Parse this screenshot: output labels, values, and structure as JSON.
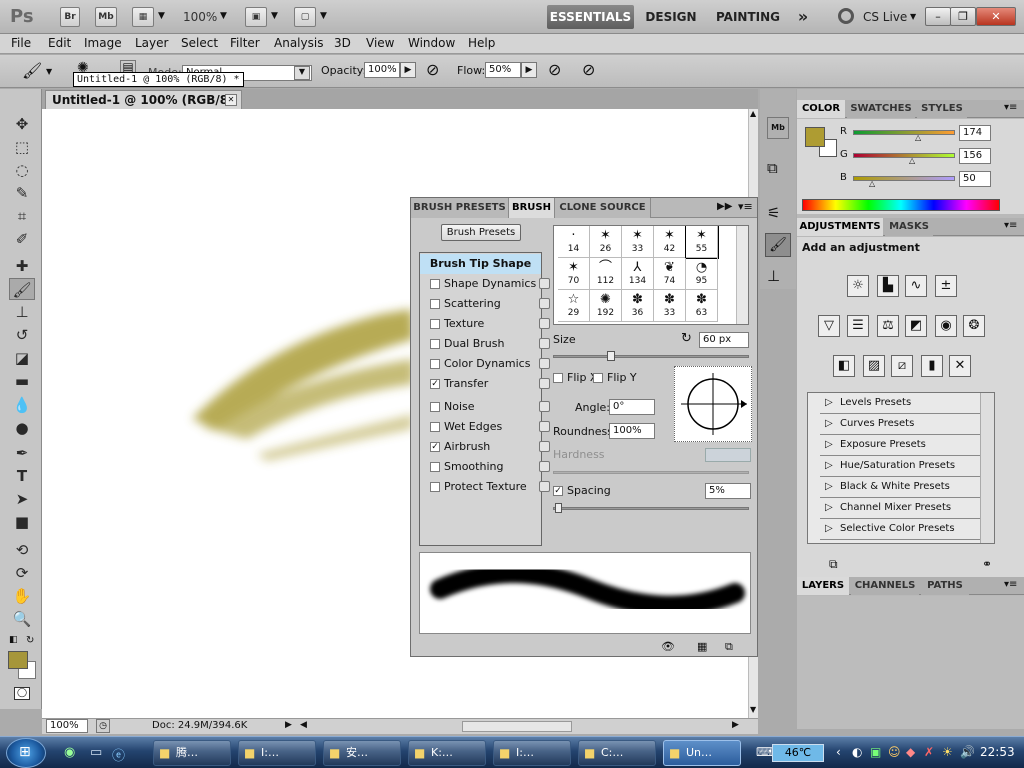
{
  "appbar": {
    "ps_logo": "Ps",
    "br": "Br",
    "mb": "Mb",
    "zoom": "100%",
    "workspaces": [
      "ESSENTIALS",
      "DESIGN",
      "PAINTING"
    ],
    "more": "»",
    "cslive": "CS Live",
    "minimize": "–",
    "restore": "❐",
    "close": "✕"
  },
  "menu": [
    "File",
    "Edit",
    "Image",
    "Layer",
    "Select",
    "Filter",
    "Analysis",
    "3D",
    "View",
    "Window",
    "Help"
  ],
  "options": {
    "mode_label": "Mode:",
    "mode_value": "Normal",
    "opacity_label": "Opacity:",
    "opacity_value": "100%",
    "flow_label": "Flow:",
    "flow_value": "50%",
    "tooltip": "Untitled-1 @ 100% (RGB/8) *"
  },
  "document": {
    "tab_title": "Untitled-1 @ 100% (RGB/8) *",
    "zoom": "100%",
    "doc_info": "Doc: 24.9M/394.6K",
    "brush_color": "#ab9d38"
  },
  "brush_panel": {
    "tabs": [
      "BRUSH PRESETS",
      "BRUSH",
      "CLONE SOURCE"
    ],
    "presets_button": "Brush Presets",
    "options": [
      {
        "label": "Brush Tip Shape",
        "checked": false,
        "header": true
      },
      {
        "label": "Shape Dynamics",
        "checked": false
      },
      {
        "label": "Scattering",
        "checked": false
      },
      {
        "label": "Texture",
        "checked": false
      },
      {
        "label": "Dual Brush",
        "checked": false
      },
      {
        "label": "Color Dynamics",
        "checked": false
      },
      {
        "label": "Transfer",
        "checked": true
      },
      {
        "label": "Noise",
        "checked": false
      },
      {
        "label": "Wet Edges",
        "checked": false
      },
      {
        "label": "Airbrush",
        "checked": true
      },
      {
        "label": "Smoothing",
        "checked": false
      },
      {
        "label": "Protect Texture",
        "checked": false
      }
    ],
    "tips": [
      {
        "g": "·",
        "s": "14"
      },
      {
        "g": "✶",
        "s": "26"
      },
      {
        "g": "✶",
        "s": "33"
      },
      {
        "g": "✶",
        "s": "42"
      },
      {
        "g": "✶",
        "s": "55"
      },
      {
        "g": "✶",
        "s": "70"
      },
      {
        "g": "⌒",
        "s": "112"
      },
      {
        "g": "⅄",
        "s": "134"
      },
      {
        "g": "❦",
        "s": "74"
      },
      {
        "g": "◔",
        "s": "95"
      },
      {
        "g": "☆",
        "s": "29"
      },
      {
        "g": "✺",
        "s": "192"
      },
      {
        "g": "✽",
        "s": "36"
      },
      {
        "g": "✽",
        "s": "33"
      },
      {
        "g": "✽",
        "s": "63"
      }
    ],
    "size_label": "Size",
    "size_value": "60 px",
    "flipx": "Flip X",
    "flipy": "Flip Y",
    "angle_label": "Angle:",
    "angle_value": "0°",
    "roundness_label": "Roundness:",
    "roundness_value": "100%",
    "hardness_label": "Hardness",
    "spacing_label": "Spacing",
    "spacing_value": "5%"
  },
  "color_panel": {
    "tabs": [
      "COLOR",
      "SWATCHES",
      "STYLES"
    ],
    "r_label": "R",
    "g_label": "G",
    "b_label": "B",
    "r": "174",
    "g": "156",
    "b": "50",
    "fg": "#ae9c32"
  },
  "adjustments": {
    "tabs": [
      "ADJUSTMENTS",
      "MASKS"
    ],
    "heading": "Add an adjustment",
    "presets": [
      "Levels Presets",
      "Curves Presets",
      "Exposure Presets",
      "Hue/Saturation Presets",
      "Black & White Presets",
      "Channel Mixer Presets",
      "Selective Color Presets"
    ]
  },
  "layers": {
    "tabs": [
      "LAYERS",
      "CHANNELS",
      "PATHS"
    ]
  },
  "taskbar": {
    "items": [
      "腾…",
      "I:…",
      "安…",
      "K:…",
      "I:…",
      "C:…",
      "Un…"
    ],
    "temp": "46℃",
    "clock": "22:53"
  }
}
